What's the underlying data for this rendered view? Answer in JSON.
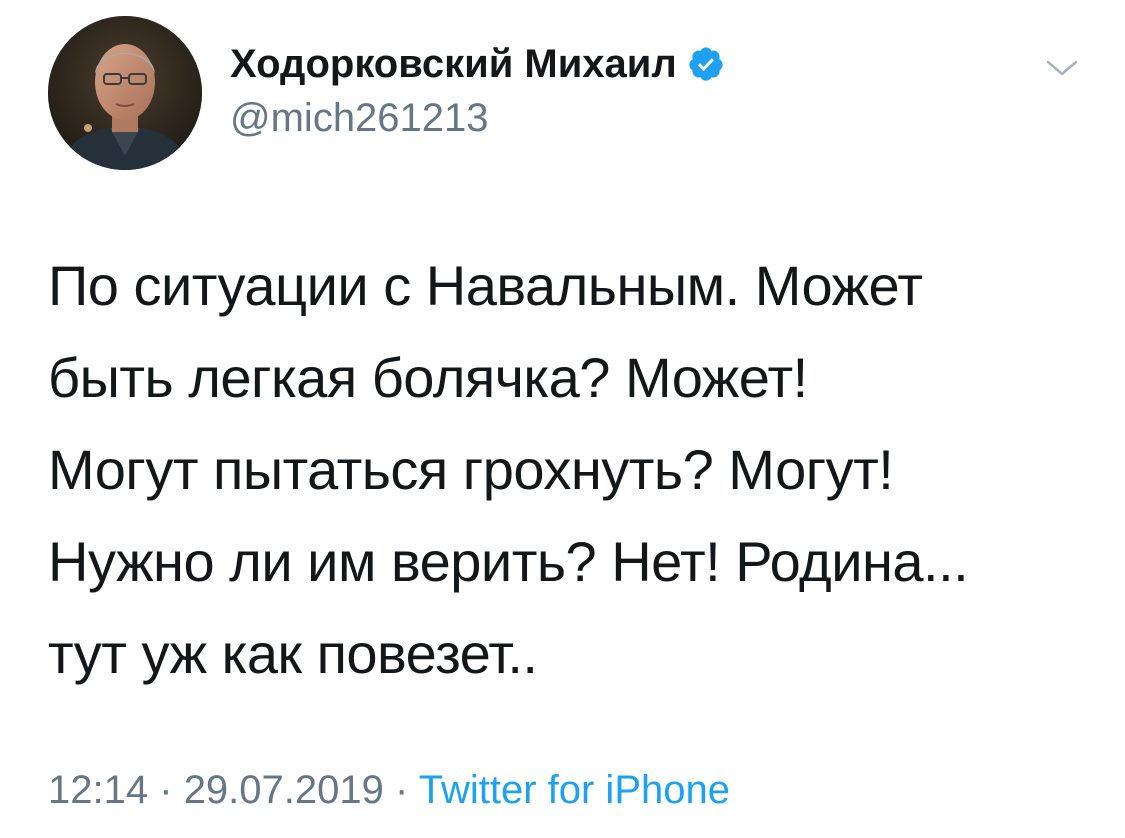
{
  "author": {
    "name": "Ходорковский Михаил",
    "handle": "@mich261213",
    "verified": true
  },
  "tweet": {
    "lines": [
      "По ситуации с Навальным. Может",
      "быть легкая болячка? Может!",
      "Могут пытаться грохнуть? Могут!",
      "Нужно ли им верить? Нет! Родина...",
      "тут уж как повезет.."
    ]
  },
  "meta": {
    "time": "12:14",
    "separator": "·",
    "date": "29.07.2019",
    "source": "Twitter for iPhone"
  },
  "colors": {
    "text": "#14171a",
    "secondary": "#657786",
    "link": "#1da1f2",
    "verified": "#1da1f2"
  },
  "icons": {
    "verified": "verified-badge-icon",
    "menu": "chevron-down-icon"
  }
}
